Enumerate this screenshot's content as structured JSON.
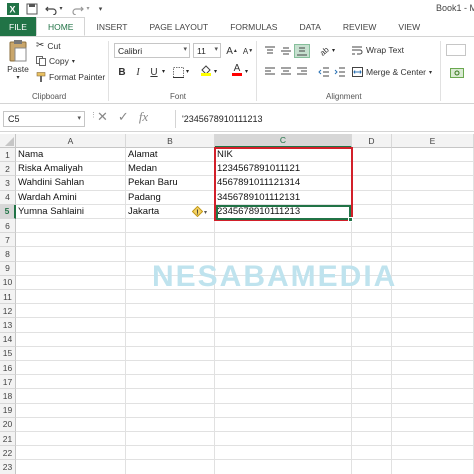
{
  "window": {
    "title": "Book1 - M"
  },
  "ribbon_tabs": [
    "FILE",
    "HOME",
    "INSERT",
    "PAGE LAYOUT",
    "FORMULAS",
    "DATA",
    "REVIEW",
    "VIEW"
  ],
  "clipboard": {
    "paste_label": "Paste",
    "cut_label": "Cut",
    "copy_label": "Copy",
    "format_painter_label": "Format Painter",
    "group_label": "Clipboard"
  },
  "font": {
    "font_name": "Calibri",
    "font_size": "11",
    "bold_label": "B",
    "italic_label": "I",
    "underline_label": "U",
    "grow_label": "A",
    "shrink_label": "A",
    "font_color_label": "A",
    "group_label": "Font",
    "fill_color": "#ffff00",
    "font_color": "#ff0000"
  },
  "alignment": {
    "wrap_text_label": "Wrap Text",
    "merge_center_label": "Merge & Center",
    "group_label": "Alignment"
  },
  "formula_bar": {
    "name_box": "C5",
    "cancel_icon": "✕",
    "enter_icon": "✓",
    "fx_label": "fx",
    "content": "'2345678910111213"
  },
  "sheet": {
    "columns": [
      "A",
      "B",
      "C",
      "D",
      "E"
    ],
    "selected_column": "C",
    "selected_row": "5",
    "row_numbers": [
      "1",
      "2",
      "3",
      "4",
      "5",
      "6",
      "7",
      "8",
      "9",
      "10",
      "11",
      "12",
      "13",
      "14",
      "15",
      "16",
      "17",
      "18",
      "19",
      "20",
      "21",
      "22",
      "23"
    ],
    "rows": [
      [
        "Nama",
        "Alamat",
        "NIK"
      ],
      [
        "Riska Amaliyah",
        "Medan",
        "1234567891011121"
      ],
      [
        "Wahdini Sahlan",
        "Pekan Baru",
        "4567891011121314"
      ],
      [
        "Wardah Amini",
        "Padang",
        "3456789101112131"
      ],
      [
        "Yumna Sahlaini",
        "Jakarta",
        "2345678910111213"
      ]
    ]
  },
  "watermark": "NESABAMEDIA",
  "colors": {
    "excel_green": "#217346",
    "highlight_red": "#d2202a"
  }
}
